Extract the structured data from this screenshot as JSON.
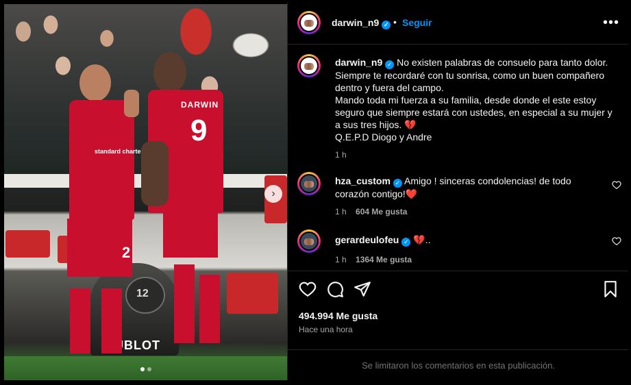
{
  "post": {
    "author": "darwin_n9",
    "follow_label": "Seguir",
    "dot": "•",
    "more_label": "•••",
    "media": {
      "jersey_numbers": [
        "9",
        "2"
      ],
      "jersey_name": "DARWIN",
      "sponsor": "standard chartered",
      "clock_text": "HUBLOT",
      "clock_number": "12",
      "slide_count": 2,
      "active_slide": 1
    },
    "caption": {
      "user": "darwin_n9",
      "lines": [
        "No existen palabras de consuelo para tanto dolor.",
        "Siempre te recordaré con tu sonrisa, como un buen compañero dentro y fuera del campo.",
        "Mando toda mi fuerza a su familia, desde donde el este estoy seguro que siempre estará con ustedes, en especial a su mujer y a sus tres hijos. 💔",
        "Q.E.P.D Diogo y Andre"
      ],
      "time": "1 h"
    },
    "comments": [
      {
        "user": "hza_custom",
        "text": "Amigo ! sinceras condolencias! de todo corazón contigo!❤️",
        "time": "1 h",
        "likes": "604 Me gusta"
      },
      {
        "user": "gerardeulofeu",
        "text": "💔..",
        "time": "1 h",
        "likes": "1364 Me gusta"
      }
    ],
    "likes_label": "494.994 Me gusta",
    "timestamp": "Hace una hora",
    "comments_limited": "Se limitaron los comentarios en esta publicación."
  },
  "colors": {
    "accent": "#0095f6",
    "background": "#000000",
    "text": "#f5f5f5",
    "muted": "#a8a8a8",
    "divider": "#262626"
  },
  "icons": [
    "verified-icon",
    "more-icon",
    "heart-icon",
    "comment-icon",
    "share-icon",
    "bookmark-icon",
    "next-arrow-icon"
  ]
}
